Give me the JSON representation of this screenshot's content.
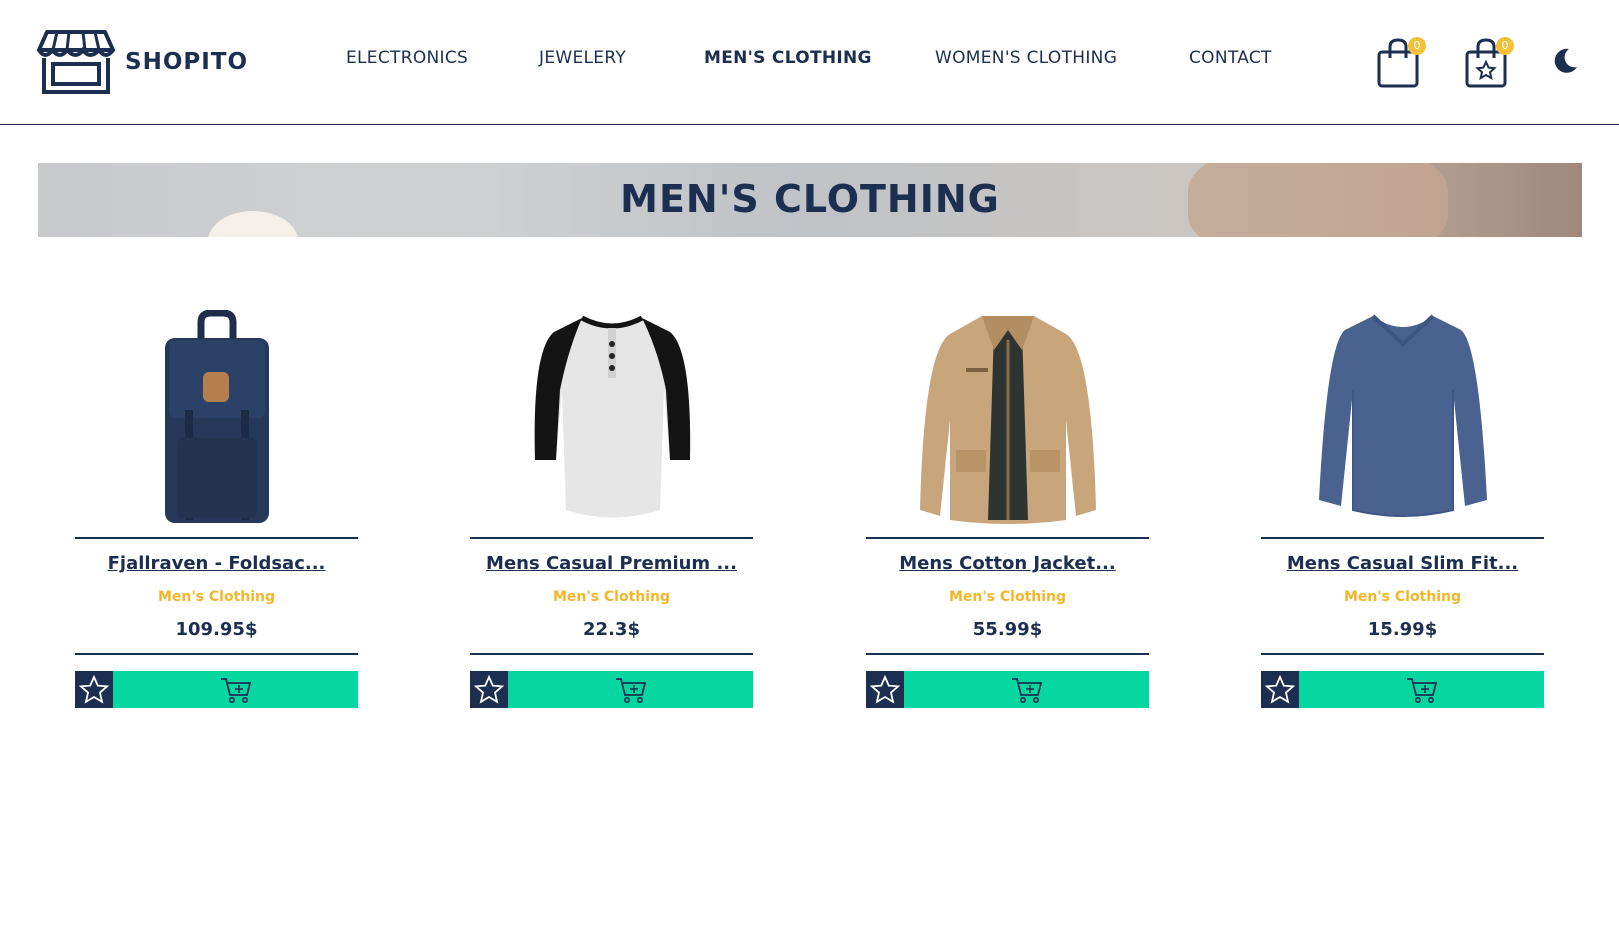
{
  "brand": {
    "name": "SHOPITO",
    "icon": "storefront-icon"
  },
  "nav": [
    {
      "label": "ELECTRONICS",
      "active": false
    },
    {
      "label": "JEWELERY",
      "active": false
    },
    {
      "label": "MEN'S CLOTHING",
      "active": true
    },
    {
      "label": "WOMEN'S CLOTHING",
      "active": false
    },
    {
      "label": "CONTACT",
      "active": false
    }
  ],
  "header_actions": {
    "cart": {
      "icon": "shopping-bag-icon",
      "count": "0"
    },
    "favorites": {
      "icon": "favorites-bag-icon",
      "count": "0"
    },
    "theme": {
      "icon": "moon-icon"
    }
  },
  "banner": {
    "title": "MEN'S CLOTHING"
  },
  "products": [
    {
      "title": "Fjallraven - Foldsac...",
      "category": "Men's Clothing",
      "price": "109.95$",
      "image": "backpack"
    },
    {
      "title": "Mens Casual Premium ...",
      "category": "Men's Clothing",
      "price": "22.3$",
      "image": "raglan-shirt"
    },
    {
      "title": "Mens Cotton Jacket...",
      "category": "Men's Clothing",
      "price": "55.99$",
      "image": "jacket"
    },
    {
      "title": "Mens Casual Slim Fit...",
      "category": "Men's Clothing",
      "price": "15.99$",
      "image": "long-sleeve-shirt"
    }
  ],
  "colors": {
    "primary": "#1c2f50",
    "accent": "#06d6a0",
    "category": "#f3b629",
    "badge": "#f3c13a"
  }
}
